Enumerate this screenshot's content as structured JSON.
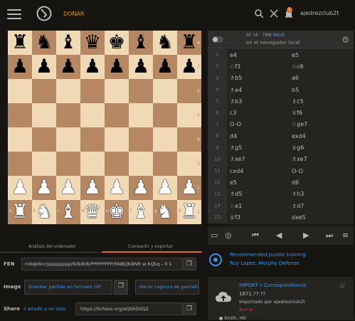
{
  "header": {
    "donate": "DONAR",
    "username": "ajedrezclub2t",
    "notif_count": "1"
  },
  "board": {
    "rows": [
      [
        "br",
        "bn",
        "bb",
        "bq",
        "bk",
        "bb",
        "bn",
        "br"
      ],
      [
        "bp",
        "bp",
        "bp",
        "bp",
        "bp",
        "bp",
        "bp",
        "bp"
      ],
      [
        "",
        "",
        "",
        "",
        "",
        "",
        "",
        ""
      ],
      [
        "",
        "",
        "",
        "",
        "",
        "",
        "",
        ""
      ],
      [
        "",
        "",
        "",
        "",
        "",
        "",
        "",
        ""
      ],
      [
        "",
        "",
        "",
        "",
        "",
        "",
        "",
        ""
      ],
      [
        "wp",
        "wp",
        "wp",
        "wp",
        "wp",
        "wp",
        "wp",
        "wp"
      ],
      [
        "wr",
        "wn",
        "wb",
        "wq",
        "wk",
        "wb",
        "wn",
        "wr"
      ]
    ],
    "ranks": [
      "8",
      "7",
      "6",
      "5",
      "4",
      "3",
      "2",
      "1"
    ],
    "files": [
      "a",
      "b",
      "c",
      "d",
      "e",
      "f",
      "g",
      "h"
    ]
  },
  "engine": {
    "name": "SF 16 · 7MB",
    "nnue": "NNUE",
    "subtitle": "en el navegador local"
  },
  "moves": [
    {
      "n": "1",
      "w": "e4",
      "b": "e5"
    },
    {
      "n": "2",
      "w": "♘f3",
      "b": "♘c6"
    },
    {
      "n": "3",
      "w": "♗b5",
      "b": "a6"
    },
    {
      "n": "4",
      "w": "♗a4",
      "b": "b5"
    },
    {
      "n": "5",
      "w": "♗b3",
      "b": "♗c5"
    },
    {
      "n": "6",
      "w": "c3",
      "b": "♕f6"
    },
    {
      "n": "7",
      "w": "O-O",
      "b": "♘ge7"
    },
    {
      "n": "8",
      "w": "d4",
      "b": "exd4"
    },
    {
      "n": "9",
      "w": "♗g5",
      "b": "♕g6"
    },
    {
      "n": "10",
      "w": "♗xe7",
      "b": "♗xe7"
    },
    {
      "n": "11",
      "w": "cxd4",
      "b": "O-O"
    },
    {
      "n": "12",
      "w": "e5",
      "b": "d6"
    },
    {
      "n": "13",
      "w": "♗d5",
      "b": "♗h3"
    },
    {
      "n": "14",
      "w": "♘e1",
      "b": "♗d7"
    },
    {
      "n": "15",
      "w": "♕f3",
      "b": "dxe5"
    }
  ],
  "tabs": {
    "analysis": "Análisis del ordenador",
    "share": "Compartir y exportar"
  },
  "fen": {
    "label": "FEN",
    "value": "rnbqkbnr/pppppppp/8/8/8/8/PPPPPPPP/RNBQKBNR w KQkq - 0 1"
  },
  "image": {
    "label": "Image",
    "gif": "Guardar partida en formato GIF",
    "screenshot": "Hacer captura de pantalla"
  },
  "share": {
    "label": "Share",
    "add": "Añadir a mi sitio",
    "url": "https://lichess.org/eQShD0Q2"
  },
  "puzzle": {
    "line1": "Recommended puzzle training",
    "line2": "Ruy Lopez: Morphy Defense"
  },
  "game": {
    "type": "IMPORT • Correspondencia",
    "moves": "1871.??.??",
    "imported": "Importado por ajedrezclub2t",
    "status": "Borrar",
    "player": "Smith, HD"
  },
  "colors": {
    "accent": "#3893e8",
    "brand": "#e4691e",
    "light": "#f0d9b5",
    "dark": "#b58863"
  }
}
